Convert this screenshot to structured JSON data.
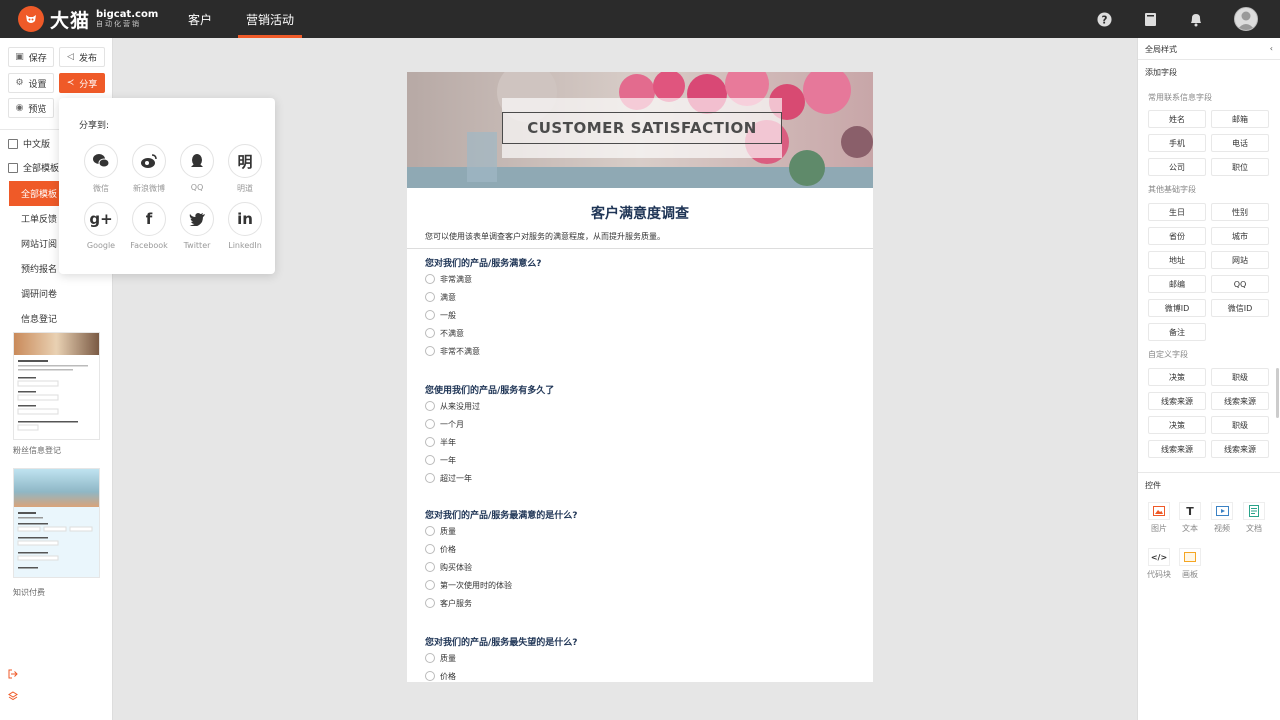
{
  "brand": {
    "name": "大猫",
    "domain": "bigcat.com",
    "tagline": "自动化营销",
    "accent": "#ef5a28"
  },
  "nav": {
    "items": [
      {
        "label": "客户",
        "active": false
      },
      {
        "label": "营销活动",
        "active": true
      }
    ]
  },
  "top_icons": [
    "help-icon",
    "book-icon",
    "bell-icon",
    "user-avatar"
  ],
  "toolbar": {
    "save": "保存",
    "publish": "发布",
    "settings": "设置",
    "share": "分享",
    "preview": "预览"
  },
  "sidebar": {
    "language": "中文版",
    "all_templates": "全部模板",
    "categories": [
      "全部模板",
      "工单反馈",
      "网站订阅",
      "预约报名",
      "调研问卷",
      "信息登记"
    ],
    "templates": [
      "粉丝信息登记",
      "知识付费"
    ]
  },
  "share_popup": {
    "title": "分享到:",
    "items": [
      {
        "label": "微信",
        "icon": "wechat-icon"
      },
      {
        "label": "新浪微博",
        "icon": "weibo-icon"
      },
      {
        "label": "QQ",
        "icon": "qq-icon"
      },
      {
        "label": "明道",
        "icon": "mingdao-icon",
        "glyph": "明"
      },
      {
        "label": "Google",
        "icon": "google-plus-icon",
        "glyph": "g+"
      },
      {
        "label": "Facebook",
        "icon": "facebook-icon",
        "glyph": "f"
      },
      {
        "label": "Twitter",
        "icon": "twitter-icon"
      },
      {
        "label": "LinkedIn",
        "icon": "linkedin-icon",
        "glyph": "in"
      }
    ]
  },
  "form": {
    "banner_text": "CUSTOMER SATISFACTION",
    "title": "客户满意度调查",
    "description": "您可以使用该表单调查客户对服务的满意程度，从而提升服务质量。",
    "questions": [
      {
        "title": "您对我们的产品/服务满意么?",
        "options": [
          "非常满意",
          "满意",
          "一般",
          "不满意",
          "非常不满意"
        ]
      },
      {
        "title": "您使用我们的产品/服务有多久了",
        "options": [
          "从来没用过",
          "一个月",
          "半年",
          "一年",
          "超过一年"
        ]
      },
      {
        "title": "您对我们的产品/服务最满意的是什么?",
        "options": [
          "质量",
          "价格",
          "购买体验",
          "第一次使用时的体验",
          "客户服务"
        ]
      },
      {
        "title": "您对我们的产品/服务最失望的是什么?",
        "options": [
          "质量",
          "价格"
        ]
      }
    ]
  },
  "right_panel": {
    "global_style": "全局样式",
    "add_field": "添加字段",
    "contact_section": "常用联系信息字段",
    "contact_fields": [
      "姓名",
      "邮箱",
      "手机",
      "电话",
      "公司",
      "职位"
    ],
    "basic_section": "其他基础字段",
    "basic_fields": [
      "生日",
      "性别",
      "省份",
      "城市",
      "地址",
      "网站",
      "邮编",
      "QQ",
      "微博ID",
      "微信ID",
      "备注"
    ],
    "custom_section": "自定义字段",
    "custom_fields": [
      "决策",
      "职级",
      "线索来源",
      "线索来源",
      "决策",
      "职级",
      "线索来源",
      "线索来源"
    ],
    "controls_title": "控件",
    "controls": [
      {
        "label": "图片",
        "icon": "image-icon",
        "color": "#ef5a28"
      },
      {
        "label": "文本",
        "icon": "text-icon",
        "color": "#333333",
        "glyph": "T"
      },
      {
        "label": "视频",
        "icon": "video-icon",
        "color": "#3b82c4"
      },
      {
        "label": "文档",
        "icon": "document-icon",
        "color": "#2aa38a"
      },
      {
        "label": "代码块",
        "icon": "code-icon",
        "color": "#333333",
        "glyph": "</>"
      },
      {
        "label": "画板",
        "icon": "canvas-icon",
        "color": "#f5a623"
      }
    ]
  }
}
